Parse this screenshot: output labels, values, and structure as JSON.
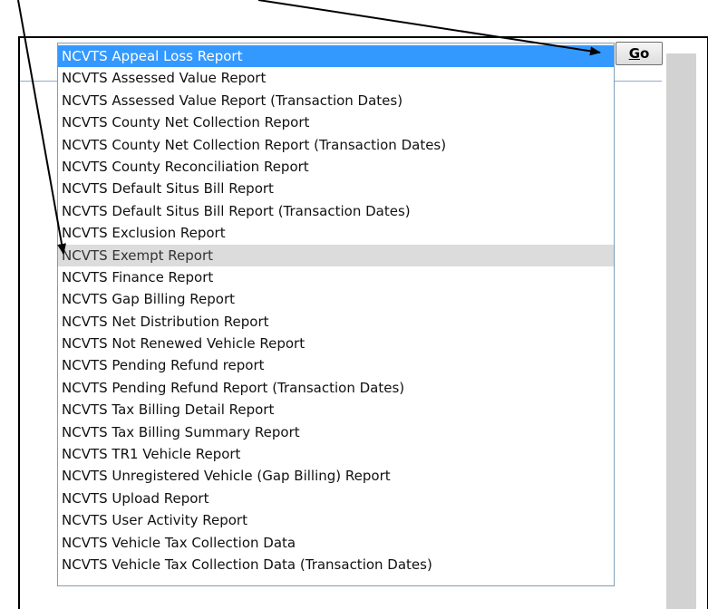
{
  "listbox": {
    "options": [
      "NCVTS Appeal Loss Report",
      "NCVTS Assessed Value Report",
      "NCVTS Assessed Value Report (Transaction Dates)",
      "NCVTS County Net Collection Report",
      "NCVTS County Net Collection Report (Transaction Dates)",
      "NCVTS County Reconciliation Report",
      "NCVTS Default Situs Bill Report",
      "NCVTS Default Situs Bill Report (Transaction Dates)",
      "NCVTS Exclusion Report",
      "NCVTS Exempt Report",
      "NCVTS Finance Report",
      "NCVTS Gap Billing Report",
      "NCVTS Net Distribution Report",
      "NCVTS Not Renewed Vehicle Report",
      "NCVTS Pending Refund report",
      "NCVTS Pending Refund Report (Transaction Dates)",
      "NCVTS Tax Billing Detail Report",
      "NCVTS Tax Billing Summary Report",
      "NCVTS TR1 Vehicle Report",
      "NCVTS Unregistered Vehicle (Gap Billing) Report",
      "NCVTS Upload Report",
      "NCVTS User Activity Report",
      "NCVTS Vehicle Tax Collection Data",
      "NCVTS Vehicle Tax Collection Data (Transaction Dates)"
    ],
    "selected_index": 0,
    "hover_index": 9
  },
  "go_button": {
    "label_first": "G",
    "label_rest": "o"
  },
  "colors": {
    "selected_bg": "#3399ff",
    "hover_bg": "#dcdcdc",
    "arrow": "#000000"
  },
  "annotations": {
    "arrow_1_target": "go-button",
    "arrow_2_target": "exempt-report-option"
  }
}
